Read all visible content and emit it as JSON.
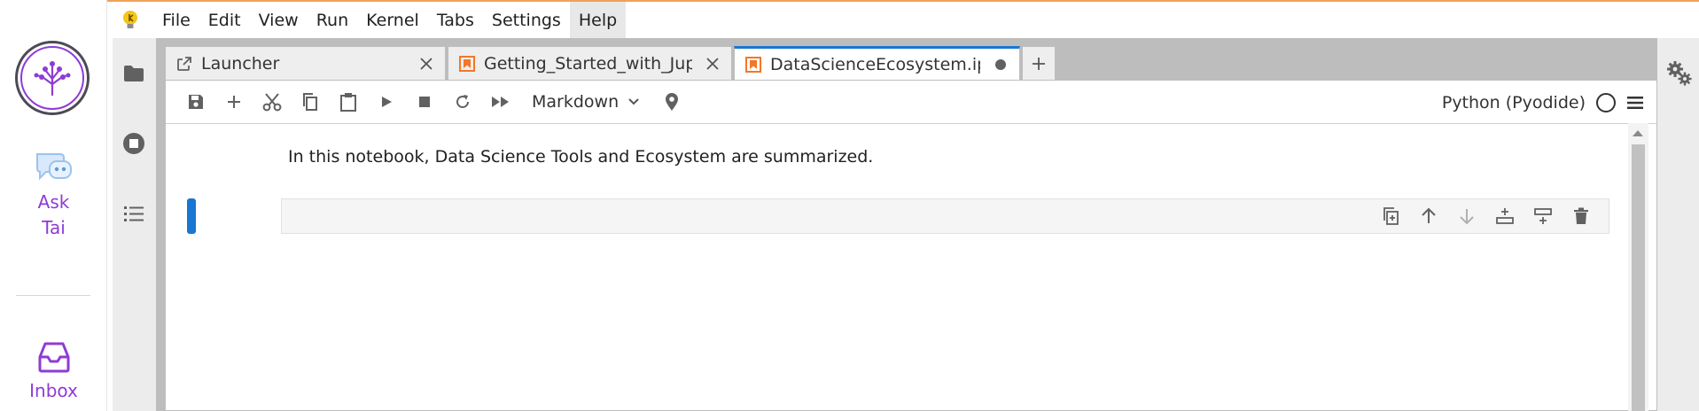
{
  "left_rail": {
    "ask_tai": {
      "line1": "Ask",
      "line2": "Tai"
    },
    "inbox": "Inbox"
  },
  "menubar": {
    "items": [
      "File",
      "Edit",
      "View",
      "Run",
      "Kernel",
      "Tabs",
      "Settings",
      "Help"
    ],
    "active_item": "Help"
  },
  "tabs": [
    {
      "label": "Launcher",
      "icon": "launch-icon",
      "state": "inactive"
    },
    {
      "label": "Getting_Started_with_Jupyter",
      "icon": "notebook-icon",
      "state": "inactive"
    },
    {
      "label": "DataScienceEcosystem.ipynb",
      "icon": "notebook-icon",
      "state": "active-unsaved"
    }
  ],
  "toolbar": {
    "cell_type": "Markdown",
    "kernel_name": "Python (Pyodide)"
  },
  "notebook": {
    "markdown_cell_text": "In this notebook, Data Science Tools and Ecosystem are summarized.",
    "code_cell_value": ""
  },
  "colors": {
    "accent_blue": "#1976d2",
    "brand_purple": "#8e3bd6",
    "notebook_orange": "#f37726",
    "top_accent": "#f0a15a"
  }
}
